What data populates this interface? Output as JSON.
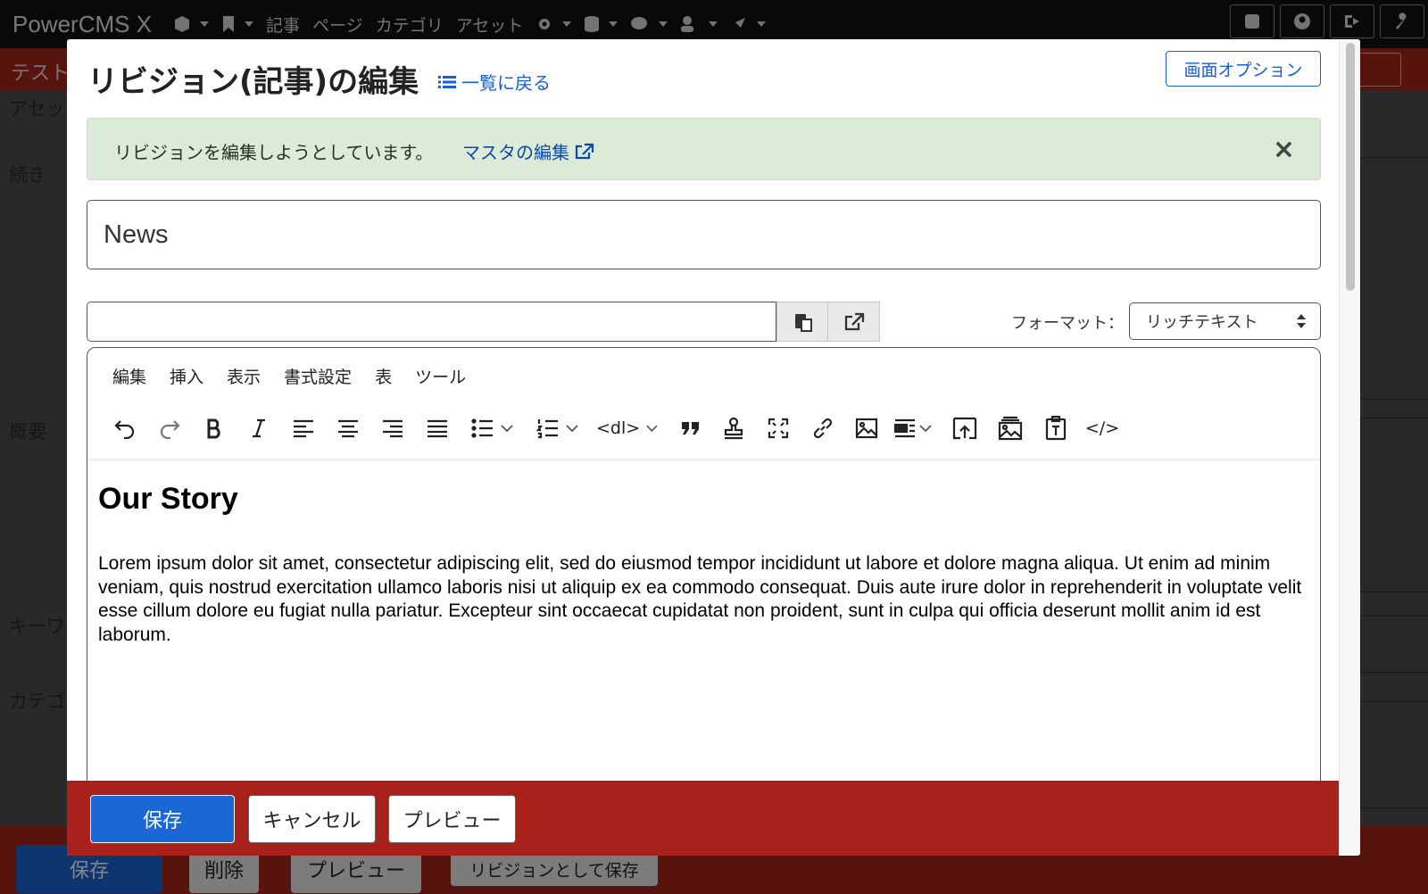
{
  "app": {
    "brand": "PowerCMS X",
    "nav": [
      "記事",
      "ページ",
      "カテゴリ",
      "アセット"
    ]
  },
  "background": {
    "subbar_title": "テスト",
    "labels": [
      "アセッ",
      "続き",
      "概要",
      "キーワ",
      "カテゴ"
    ],
    "buttons": {
      "save": "保存",
      "delete": "削除",
      "preview": "プレビュー",
      "save_revision": "リビジョンとして保存"
    }
  },
  "modal": {
    "title": "リビジョン(記事)の編集",
    "back_link": "一覧に戻る",
    "screen_options": "画面オプション",
    "alert": {
      "text": "リビジョンを編集しようとしています。",
      "link": "マスタの編集",
      "close": "×"
    },
    "title_value": "News",
    "basename_value": "",
    "format_label": "フォーマット：",
    "format_value": "リッチテキスト",
    "editor": {
      "menu": [
        "編集",
        "挿入",
        "表示",
        "書式設定",
        "表",
        "ツール"
      ],
      "dl_label": "<dl>",
      "code_label": "</>",
      "heading": "Our Story",
      "body": "Lorem ipsum dolor sit amet, consectetur adipiscing elit, sed do eiusmod tempor incididunt ut labore et dolore magna aliqua. Ut enim ad minim veniam, quis nostrud exercitation ullamco laboris nisi ut aliquip ex ea commodo consequat. Duis aute irure dolor in reprehenderit in voluptate velit esse cillum dolore eu fugiat nulla pariatur. Excepteur sint occaecat cupidatat non proident, sunt in culpa qui officia deserunt mollit anim id est laborum."
    },
    "footer": {
      "save": "保存",
      "cancel": "キャンセル",
      "preview": "プレビュー"
    }
  },
  "colors": {
    "accent": "#1a68d6",
    "danger_bar": "#a8211a",
    "alert_bg": "#dcebd7",
    "link": "#1a5fd0"
  }
}
